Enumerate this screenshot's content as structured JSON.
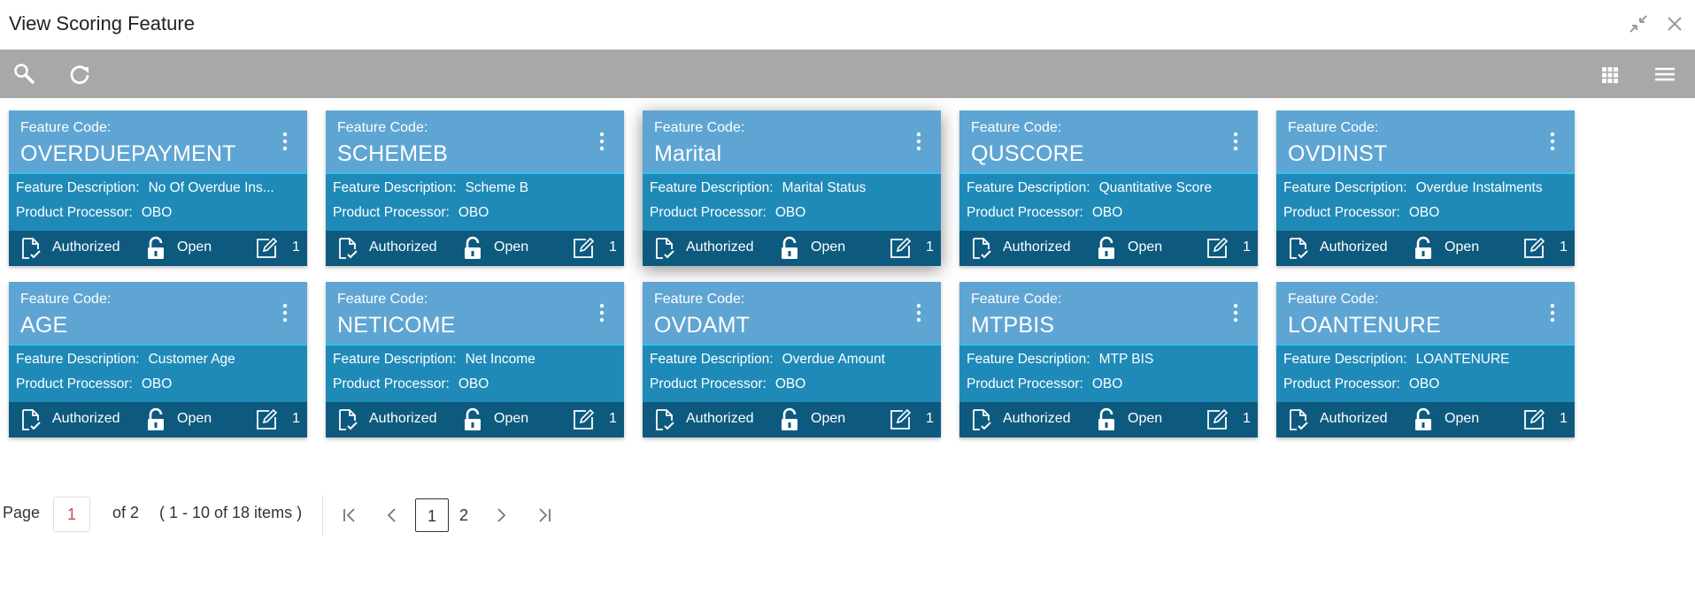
{
  "window": {
    "title": "View Scoring Feature"
  },
  "cards": [
    {
      "code_label": "Feature Code:",
      "code": "OVERDUEPAYMENT",
      "desc_label": "Feature Description:",
      "desc": "No Of Overdue Ins...",
      "proc_label": "Product Processor:",
      "proc": "OBO",
      "status": "Authorized",
      "lock": "Open",
      "count": "1"
    },
    {
      "code_label": "Feature Code:",
      "code": "SCHEMEB",
      "desc_label": "Feature Description:",
      "desc": "Scheme B",
      "proc_label": "Product Processor:",
      "proc": "OBO",
      "status": "Authorized",
      "lock": "Open",
      "count": "1"
    },
    {
      "code_label": "Feature Code:",
      "code": "Marital",
      "desc_label": "Feature Description:",
      "desc": "Marital Status",
      "proc_label": "Product Processor:",
      "proc": "OBO",
      "status": "Authorized",
      "lock": "Open",
      "count": "1"
    },
    {
      "code_label": "Feature Code:",
      "code": "QUSCORE",
      "desc_label": "Feature Description:",
      "desc": "Quantitative Score",
      "proc_label": "Product Processor:",
      "proc": "OBO",
      "status": "Authorized",
      "lock": "Open",
      "count": "1"
    },
    {
      "code_label": "Feature Code:",
      "code": "OVDINST",
      "desc_label": "Feature Description:",
      "desc": "Overdue Instalments",
      "proc_label": "Product Processor:",
      "proc": "OBO",
      "status": "Authorized",
      "lock": "Open",
      "count": "1"
    },
    {
      "code_label": "Feature Code:",
      "code": "AGE",
      "desc_label": "Feature Description:",
      "desc": "Customer Age",
      "proc_label": "Product Processor:",
      "proc": "OBO",
      "status": "Authorized",
      "lock": "Open",
      "count": "1"
    },
    {
      "code_label": "Feature Code:",
      "code": "NETICOME",
      "desc_label": "Feature Description:",
      "desc": "Net Income",
      "proc_label": "Product Processor:",
      "proc": "OBO",
      "status": "Authorized",
      "lock": "Open",
      "count": "1"
    },
    {
      "code_label": "Feature Code:",
      "code": "OVDAMT",
      "desc_label": "Feature Description:",
      "desc": "Overdue Amount",
      "proc_label": "Product Processor:",
      "proc": "OBO",
      "status": "Authorized",
      "lock": "Open",
      "count": "1"
    },
    {
      "code_label": "Feature Code:",
      "code": "MTPBIS",
      "desc_label": "Feature Description:",
      "desc": "MTP BIS",
      "proc_label": "Product Processor:",
      "proc": "OBO",
      "status": "Authorized",
      "lock": "Open",
      "count": "1"
    },
    {
      "code_label": "Feature Code:",
      "code": "LOANTENURE",
      "desc_label": "Feature Description:",
      "desc": "LOANTENURE",
      "proc_label": "Product Processor:",
      "proc": "OBO",
      "status": "Authorized",
      "lock": "Open",
      "count": "1"
    }
  ],
  "pagination": {
    "page_label": "Page",
    "current_page": "1",
    "of_label": "of 2",
    "range_label": "( 1 - 10 of 18 items )",
    "pages": [
      "1",
      "2"
    ]
  },
  "icons": {
    "title_bar": [
      "minimize-icon",
      "close-icon"
    ],
    "toolbar": [
      "search-icon",
      "refresh-icon",
      "grid-view-icon",
      "list-view-icon"
    ],
    "card": [
      "kebab-menu-icon",
      "authorized-icon",
      "unlock-icon",
      "edit-icon"
    ],
    "pager": [
      "first-page-icon",
      "prev-page-icon",
      "next-page-icon",
      "last-page-icon"
    ]
  },
  "colors": {
    "card_header": "#5fa5d3",
    "card_body": "#1f8ab8",
    "card_footer": "#0e5a7f",
    "toolbar": "#a8a8a8"
  }
}
